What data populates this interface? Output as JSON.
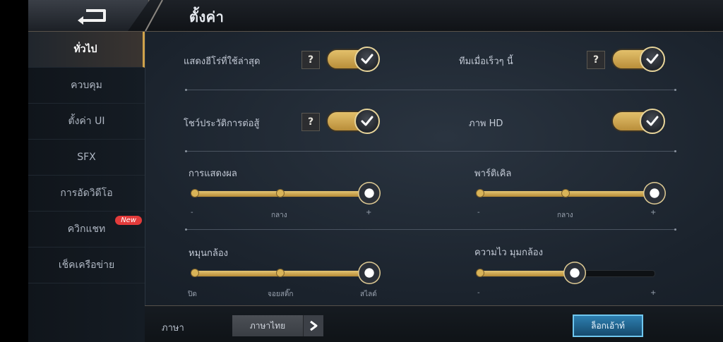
{
  "header": {
    "title": "ตั้งค่า"
  },
  "sidebar": {
    "items": [
      {
        "label": "ทั่วไป",
        "active": true
      },
      {
        "label": "ควบคุม"
      },
      {
        "label": "ตั้งค่า UI"
      },
      {
        "label": "SFX"
      },
      {
        "label": "การอัดวิดีโอ"
      },
      {
        "label": "ควิกแชท",
        "badge": "New"
      },
      {
        "label": "เช็คเครือข่าย"
      }
    ]
  },
  "toggles": {
    "recent_heroes": {
      "label": "แสดงฮีโร่ที่ใช้ล่าสุด",
      "help": "?",
      "on": true
    },
    "recent_team": {
      "label": "ทีมเมื่อเร็วๆ นี้",
      "help": "?",
      "on": true
    },
    "battle_history": {
      "label": "โชว์ประวัติการต่อสู้",
      "help": "?",
      "on": true
    },
    "hd_image": {
      "label": "ภาพ HD",
      "on": true
    }
  },
  "sliders": {
    "display": {
      "label": "การแสดงผล",
      "ticks": [
        "-",
        "กลาง",
        "+"
      ],
      "value": 1.0
    },
    "particles": {
      "label": "พาร์ติเคิล",
      "ticks": [
        "-",
        "กลาง",
        "+"
      ],
      "value": 1.0
    },
    "camera_rotation": {
      "label": "หมุนกล้อง",
      "ticks": [
        "ปิด",
        "จอยสติ๊ก",
        "สไลด์"
      ],
      "value": 1.0
    },
    "camera_speed": {
      "label": "ความไว มุมกล้อง",
      "ticks": [
        "-",
        "+"
      ],
      "value": 0.55
    }
  },
  "bottom": {
    "language_label": "ภาษา",
    "language_value": "ภาษาไทย",
    "logout_label": "ล็อกเอ้าท์"
  },
  "colors": {
    "accent_gold": "#d9b458",
    "logout_blue": "#2d7fb0",
    "badge_red": "#e33b3b"
  }
}
